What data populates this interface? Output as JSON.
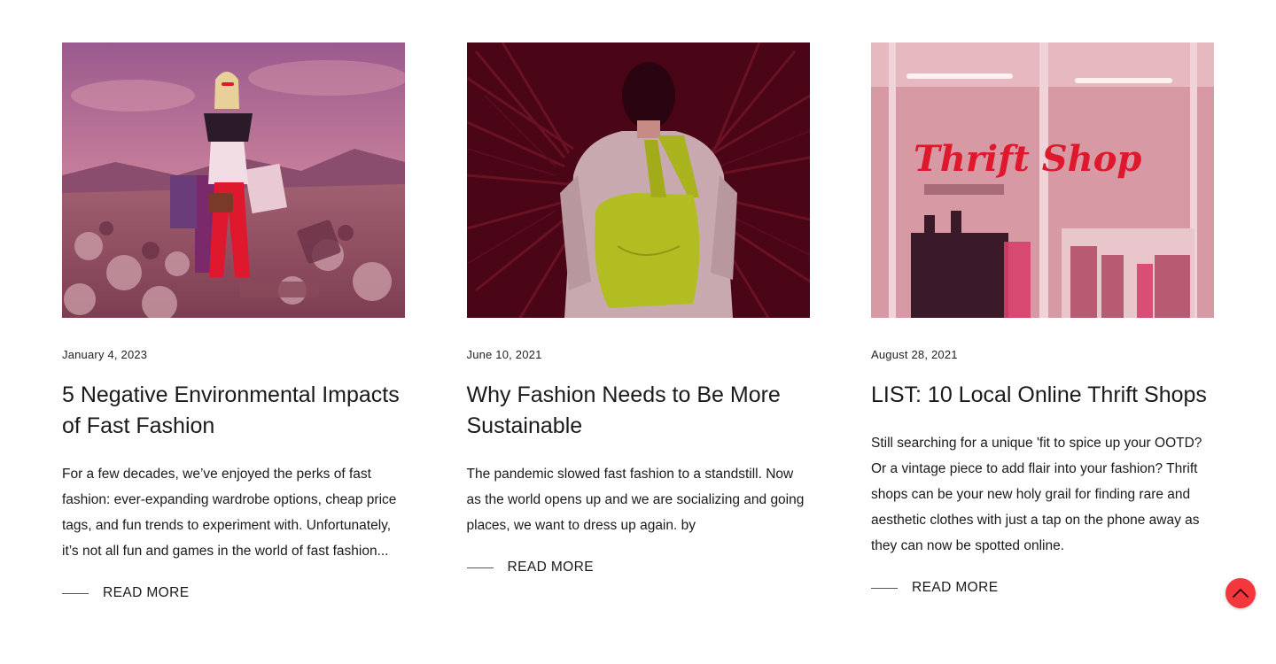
{
  "posts": [
    {
      "image": "woman-shopping-bags-landfill-photo",
      "date": "January 4, 2023",
      "title": "5 Negative Environmental Impacts of Fast Fashion",
      "excerpt": "For a few decades, we’ve enjoyed the perks of fast fashion: ever-expanding wardrobe options, cheap price tags, and fun trends to experiment with. Unfortunately, it’s not all fun and games in the world of fast fashion...",
      "read_more": "READ MORE"
    },
    {
      "image": "woman-with-tote-bag-palm-leaves-photo",
      "date": "June 10, 2021",
      "title": "Why Fashion Needs to Be More Sustainable",
      "excerpt": "The pandemic slowed fast fashion to a standstill. Now as the world opens up and we are socializing and going places, we want to dress up again. by",
      "read_more": "READ MORE"
    },
    {
      "image": "thrift-shop-storefront-photo",
      "date": "August 28, 2021",
      "title": "LIST: 10 Local Online Thrift Shops",
      "excerpt": "Still searching for a unique 'fit to spice up your OOTD? Or a vintage piece to add flair into your fashion? Thrift shops can be your new holy grail for finding rare and aesthetic clothes with just a tap on the phone away as they can now be spotted online.",
      "read_more": "READ MORE"
    }
  ],
  "thrift_sign": "Thrift Shop",
  "scroll_top": {
    "icon": "chevron-up-icon"
  },
  "colors": {
    "accent": "#f3373d",
    "overlay": "#c0112b",
    "text": "#1a1a1a"
  }
}
